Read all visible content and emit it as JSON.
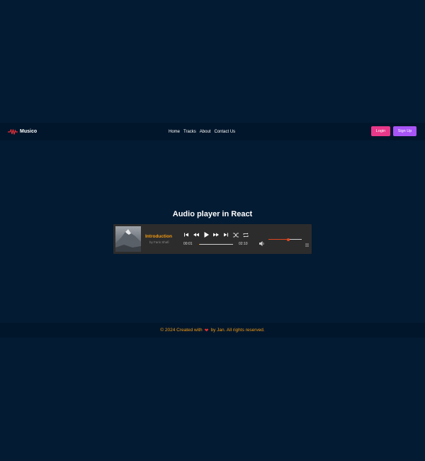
{
  "nav": {
    "brand": "Musico",
    "links": [
      "Home",
      "Tracks",
      "About",
      "Contact Us"
    ],
    "login": "Login",
    "signup": "Sign Up"
  },
  "page": {
    "title": "Audio player in React"
  },
  "player": {
    "track_title": "Introduction",
    "artist": "by Faris Shafi",
    "current_time": "00:01",
    "duration": "02:10",
    "progress": 0.01,
    "volume": 0.6,
    "icons": [
      "skip-back-icon",
      "rewind-icon",
      "play-icon",
      "fast-forward-icon",
      "skip-forward-icon",
      "shuffle-icon",
      "repeat-icon",
      "volume-icon",
      "playlist-icon"
    ]
  },
  "footer": {
    "prefix": "© 2024 Created with",
    "suffix": "by Jan. All rights reserved."
  },
  "colors": {
    "background": "#031b33",
    "navbar": "#02162b",
    "accent": "#f29a12",
    "login": "#e8388a",
    "signup": "#a855f7",
    "volume": "#e0471f"
  }
}
